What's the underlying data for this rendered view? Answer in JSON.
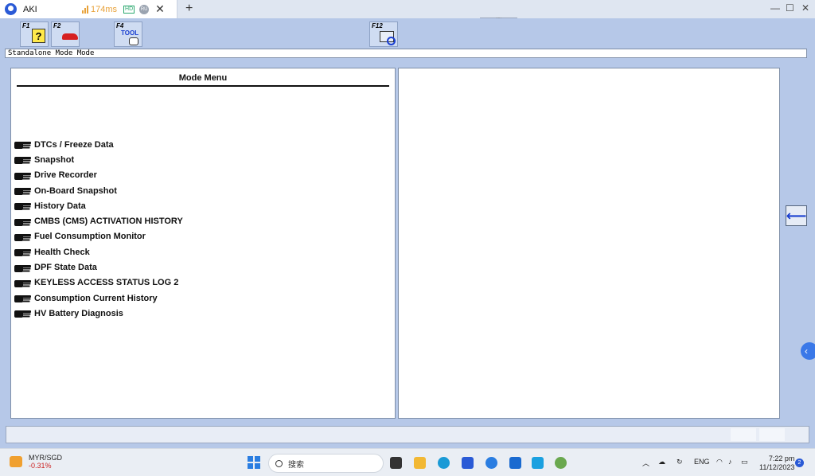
{
  "browser": {
    "tab_title": "AKI",
    "ping": "174ms",
    "hd_badge": "HD",
    "region_badge": "RU",
    "close_glyph": "✕",
    "new_tab_glyph": "+"
  },
  "toolbar": {
    "keys": [
      {
        "label": "F1",
        "icon": "help-icon"
      },
      {
        "label": "F2",
        "icon": "car-icon"
      },
      {
        "label": "F4",
        "icon": "tool-icon",
        "icon_text": "TOOL"
      },
      {
        "label": "F12",
        "icon": "scan-icon"
      }
    ]
  },
  "mode_line": "Standalone Mode Mode",
  "menu": {
    "title": "Mode Menu",
    "items": [
      "DTCs / Freeze Data",
      "Snapshot",
      "Drive Recorder",
      "On-Board Snapshot",
      "History Data",
      "CMBS (CMS) ACTIVATION HISTORY",
      "Fuel Consumption Monitor",
      "Health Check",
      "DPF State Data",
      "KEYLESS ACCESS STATUS LOG 2",
      "Consumption Current History",
      "HV Battery Diagnosis"
    ]
  },
  "back_arrow": "⟵",
  "taskbar": {
    "stock_name": "MYR/SGD",
    "stock_change": "-0.31%",
    "search_placeholder": "搜索",
    "language": "ENG",
    "time": "7:22 pm",
    "date": "11/12/2023",
    "notification_count": "2"
  },
  "colors": {
    "app_background": "#b6c8e8",
    "accent_blue": "#1a3fd0",
    "ping_orange": "#e8a23a"
  }
}
